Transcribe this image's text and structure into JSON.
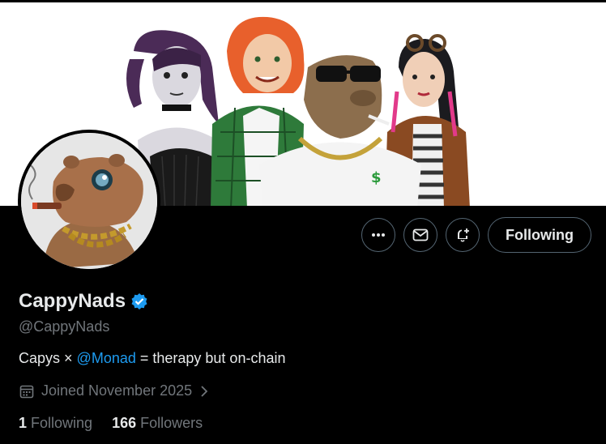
{
  "profile": {
    "display_name": "CappyNads",
    "handle": "@CappyNads",
    "verified": true,
    "bio": {
      "prefix": "Capys × ",
      "mention": "@Monad",
      "suffix": " = therapy but on-chain"
    },
    "joined": "Joined November 2025",
    "following_count": "1",
    "following_label": "Following",
    "followers_count": "166",
    "followers_label": "Followers"
  },
  "actions": {
    "more_icon": "more-icon",
    "message_icon": "mail-icon",
    "notify_icon": "bell-add-icon",
    "following_button": "Following"
  },
  "colors": {
    "background": "#000000",
    "text": "#e7e9ea",
    "secondary": "#71767b",
    "accent": "#1d9bf0",
    "border": "#536471"
  }
}
